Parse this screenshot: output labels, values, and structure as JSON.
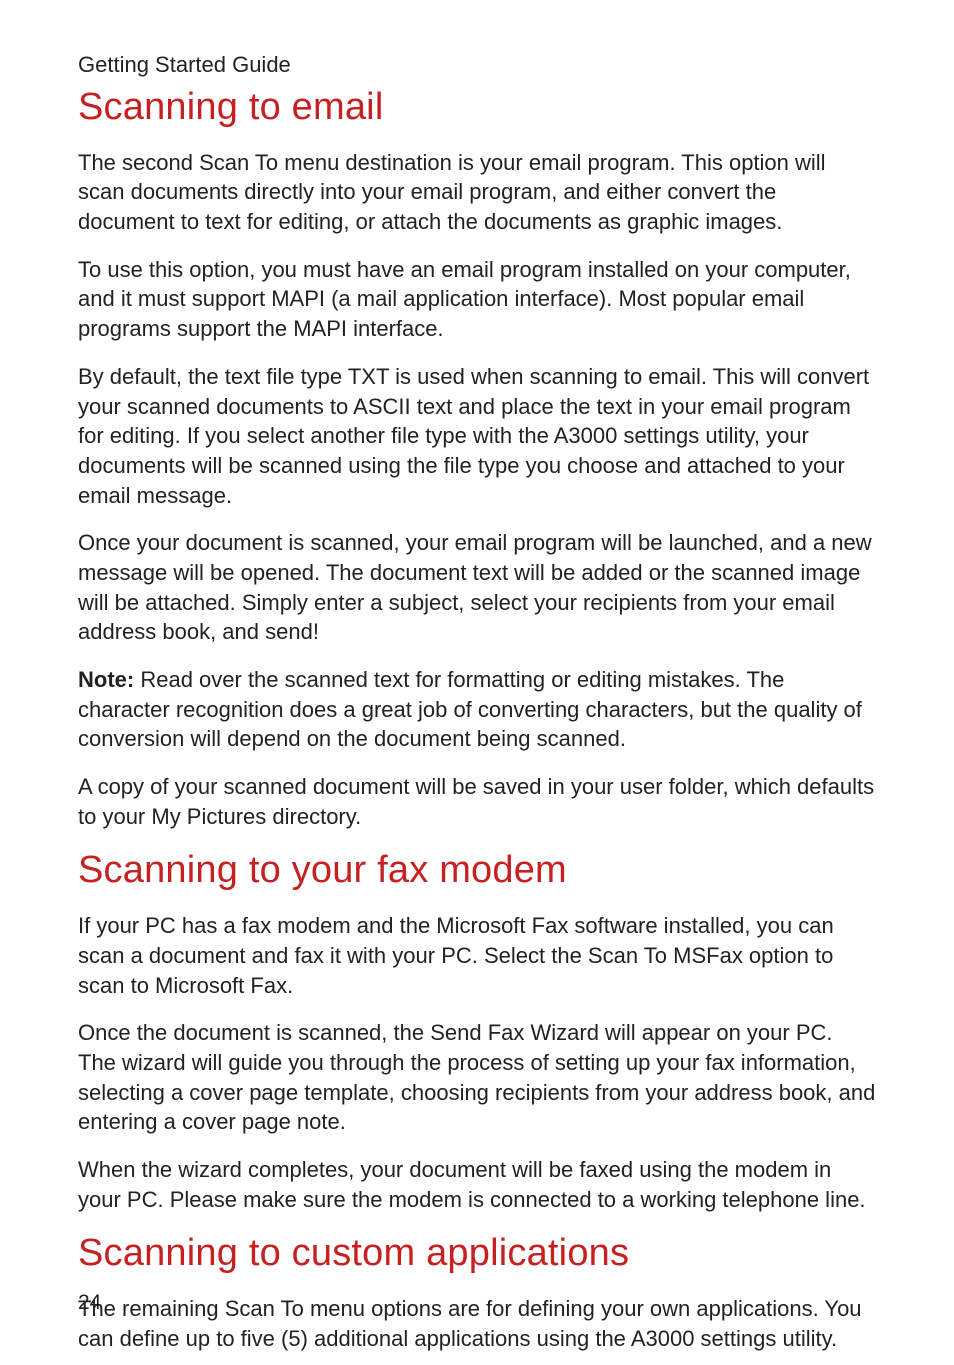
{
  "header": "Getting Started Guide",
  "sections": [
    {
      "heading": "Scanning to email",
      "paragraphs": [
        {
          "note": false,
          "text": "The second Scan To menu destination is your email program. This option will scan documents directly into your email program, and either convert the document to text for editing, or attach the documents as graphic images."
        },
        {
          "note": false,
          "text": "To use this option, you must have an email program installed on your computer, and it must support MAPI (a mail application interface). Most popular email programs support the MAPI interface."
        },
        {
          "note": false,
          "text": "By default, the text file type TXT is used when scanning to email. This will convert your scanned documents to ASCII text and place the text in your email program for editing. If you select another file type with the A3000 settings utility, your documents will be scanned using the file type you choose and attached to your email message."
        },
        {
          "note": false,
          "text": "Once your document is scanned, your email program will be launched, and a new message will be opened. The document text will be added or the scanned image will be attached. Simply enter a subject, select your recipients from your email address book, and send!"
        },
        {
          "note": true,
          "noteLabel": "Note:",
          "text": " Read over the scanned text for formatting or editing mistakes. The character recognition does a great job of converting characters, but the quality of conversion will depend on the document being scanned."
        },
        {
          "note": false,
          "text": "A copy of your scanned document will be saved in your user folder, which defaults to your My Pictures directory."
        }
      ]
    },
    {
      "heading": "Scanning to your fax modem",
      "paragraphs": [
        {
          "note": false,
          "text": "If your PC has a fax modem and the Microsoft Fax software installed, you can scan a document and fax it with your PC. Select the Scan To MSFax option to scan to Microsoft Fax."
        },
        {
          "note": false,
          "text": "Once the document is scanned, the Send Fax Wizard will appear on your PC. The wizard will guide you through the process of setting up your fax information, selecting a cover page template, choosing recipients from your address book, and entering a cover page note."
        },
        {
          "note": false,
          "text": "When the wizard completes, your document will be faxed using the modem in your PC. Please make sure the modem is connected to a working telephone line."
        }
      ]
    },
    {
      "heading": "Scanning to custom applications",
      "paragraphs": [
        {
          "note": false,
          "text": "The remaining Scan To menu options are for defining your own applications. You can define up to five (5) additional applications using the A3000 settings utility."
        }
      ]
    }
  ],
  "pageNumber": "24"
}
